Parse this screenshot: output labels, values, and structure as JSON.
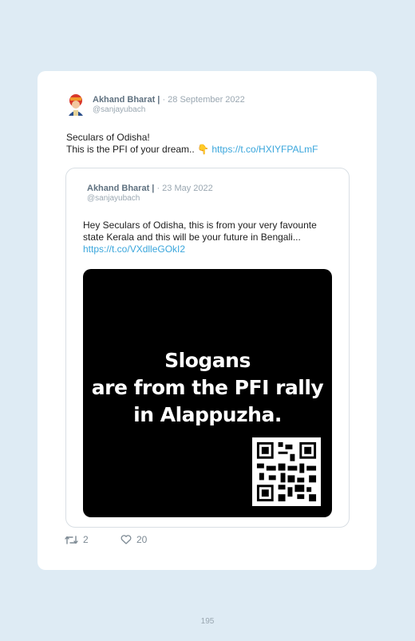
{
  "tweet": {
    "author_name": "Akhand Bharat |",
    "date": "· 28 September 2022",
    "handle": "@sanjayubach",
    "text_line1": "Seculars of Odisha!",
    "text_line2": "This is the PFI of your dream.. 👇",
    "link": "https://t.co/HXIYFPALmF"
  },
  "quoted": {
    "author_name": "Akhand Bharat |",
    "date": "· 23 May 2022",
    "handle": "@sanjayubach",
    "text": "Hey Seculars of Odisha, this is from your very favounte state Kerala and this will be your future in Bengali... ",
    "link": "https://t.co/VXdlleGOkI2",
    "media_line1": "Slogans",
    "media_line2": "are from the PFI rally",
    "media_line3": "in Alappuzha."
  },
  "actions": {
    "retweet_count": "2",
    "like_count": "20"
  },
  "page_number": "195"
}
